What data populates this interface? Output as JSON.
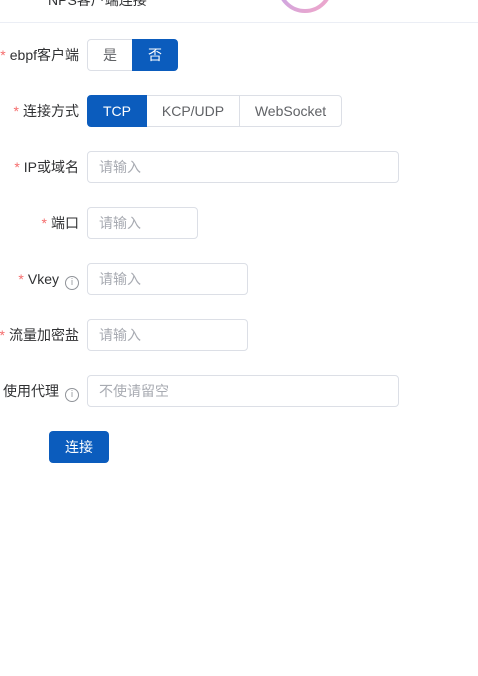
{
  "header": {
    "title": "NPS客户端连接"
  },
  "form": {
    "ebpf": {
      "label": "ebpf客户端",
      "options": [
        "是",
        "否"
      ],
      "selected": "否"
    },
    "protocol": {
      "label": "连接方式",
      "options": [
        "TCP",
        "KCP/UDP",
        "WebSocket"
      ],
      "selected": "TCP"
    },
    "host": {
      "label": "IP或域名",
      "placeholder": "请输入"
    },
    "port": {
      "label": "端口",
      "placeholder": "请输入"
    },
    "vkey": {
      "label": "Vkey",
      "placeholder": "请输入"
    },
    "salt": {
      "label": "流量加密盐",
      "placeholder": "请输入"
    },
    "proxy": {
      "label": "使用代理",
      "placeholder": "不使请留空"
    },
    "required_mark": "*",
    "info_glyph": "i"
  },
  "actions": {
    "connect_label": "连接"
  },
  "colors": {
    "primary": "#0b5cbd",
    "required": "#f56c6c"
  }
}
